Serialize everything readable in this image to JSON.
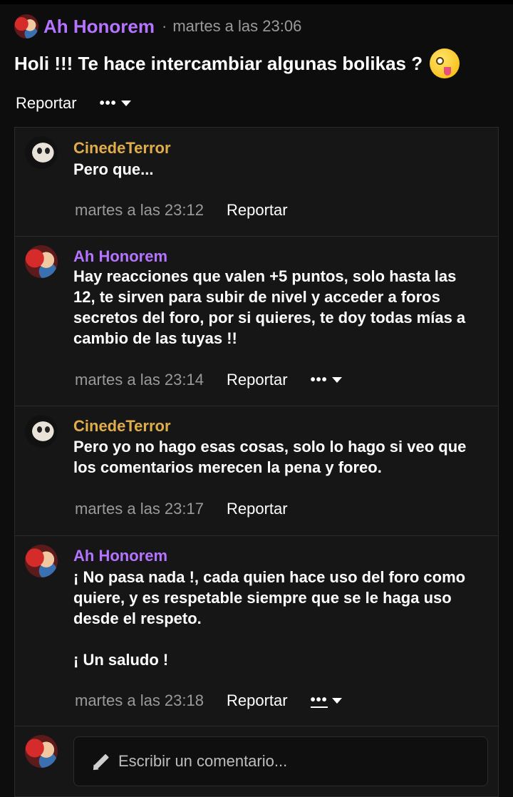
{
  "post": {
    "author": "Ah Honorem",
    "separator": "·",
    "time": "martes a las 23:06",
    "body": "Holi !!! Te hace intercambiar algunas bolikas ?",
    "emoji": "zany-face",
    "report": "Reportar",
    "more": "•••"
  },
  "comments": [
    {
      "author": "CinedeTerror",
      "avatar": "terror",
      "text": "Pero que...",
      "time": "martes a las 23:12",
      "report": "Reportar"
    },
    {
      "author": "Ah Honorem",
      "avatar": "honorem",
      "text": "Hay reacciones que valen +5 puntos, solo hasta las\n12, te sirven para subir de nivel y acceder a foros\nsecretos del foro, por si quieres, te doy todas mías a\ncambio de las tuyas !!",
      "time": "martes a las 23:14",
      "report": "Reportar",
      "more": "•••"
    },
    {
      "author": "CinedeTerror",
      "avatar": "terror",
      "text": "Pero yo no hago esas cosas, solo lo hago si veo que\nlos comentarios merecen la pena y foreo.",
      "time": "martes a las 23:17",
      "report": "Reportar"
    },
    {
      "author": "Ah Honorem",
      "avatar": "honorem",
      "text": "¡ No pasa nada !, cada quien hace uso del foro como\nquiere, y es respetable siempre que se le haga uso\ndesde el respeto.\n\n¡ Un saludo !",
      "time": "martes a las 23:18",
      "report": "Reportar",
      "more": "•••"
    }
  ],
  "compose": {
    "placeholder": "Escribir un comentario..."
  },
  "colors": {
    "background": "#0d0d0d",
    "panel": "#161616",
    "purple_name": "#b574ff",
    "gold_name": "#e0ad4a",
    "muted": "#9a9a9a"
  }
}
